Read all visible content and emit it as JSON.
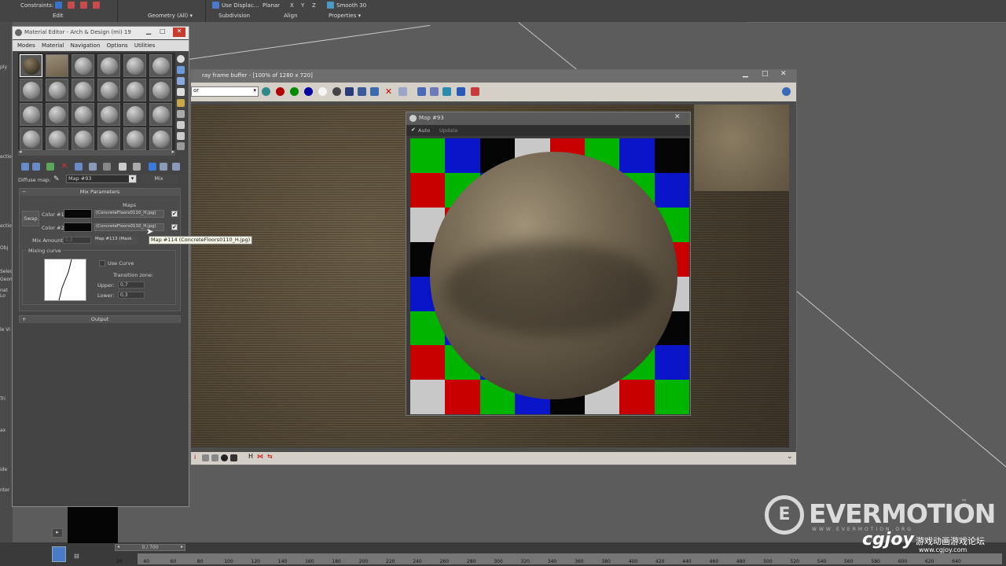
{
  "ribbon": {
    "constraints_label": "Constraints:",
    "use_displace": "Use Displac...",
    "planar": "Planar",
    "x": "X",
    "y": "Y",
    "z": "Z",
    "smooth": "Smooth 30",
    "edit": "Edit",
    "geometry_all": "Geometry (All) ▾",
    "subdivision": "Subdivision",
    "align": "Align",
    "properties": "Properties ▾"
  },
  "left_strip_labels": [
    "ply",
    "ection",
    "ection",
    "Obj",
    "Selec",
    "Geom",
    "nat Lo",
    "le Vi",
    "Tri",
    "ax",
    "ide",
    "nter"
  ],
  "material_editor": {
    "title": "Material Editor - Arch & Design (mi) 19",
    "menu": [
      "Modes",
      "Material",
      "Navigation",
      "Options",
      "Utilities"
    ],
    "diffuse_label": "Diffuse map:",
    "map_name": "Map #93",
    "map_type": "Mix",
    "mix_parameters": "Mix Parameters",
    "maps_label": "Maps",
    "swap": "Swap",
    "color1_label": "Color #1",
    "color2_label": "Color #2",
    "map1": "(ConcreteFloors0110_H.jpg)",
    "map2": "(ConcreteFloors0110_H.jpg)",
    "mix_amount_label": "Mix Amount:",
    "mix_amount_value": "0,0",
    "mix_map": "Map #113 (Mask",
    "mixing_curve": "Mixing curve",
    "use_curve": "Use Curve",
    "transition_zone": "Transition zone:",
    "upper_label": "Upper:",
    "upper_value": "0,7",
    "lower_label": "Lower:",
    "lower_value": "0,3",
    "output": "Output"
  },
  "tooltip": "Map #114 (ConcreteFloors0110_H.jpg)",
  "frame_buffer": {
    "title": "ray frame buffer - [100% of 1280 x 720]",
    "dropdown": "or"
  },
  "map93": {
    "title": "Map #93",
    "auto": "Auto",
    "update": "Update"
  },
  "timeline": {
    "frame": "0 / 700",
    "ticks": [
      "20",
      "40",
      "60",
      "80",
      "100",
      "120",
      "140",
      "160",
      "180",
      "200",
      "220",
      "240",
      "260",
      "280",
      "300",
      "320",
      "340",
      "360",
      "380",
      "400",
      "420",
      "440",
      "460",
      "480",
      "500",
      "520",
      "540",
      "560",
      "580",
      "600",
      "620",
      "640"
    ]
  },
  "watermark": {
    "brand": "EVERMOTION",
    "tm": "™",
    "site": "WWW.EVERMOTION.ORG",
    "cgjoy": "cgjoy",
    "cn": "游戏动画游戏论坛",
    "url": "www.cgjoy.com"
  },
  "colors": {
    "checker": [
      "#00b400",
      "#0a14c8",
      "#050505",
      "#c8c8c8",
      "#c80000"
    ]
  }
}
